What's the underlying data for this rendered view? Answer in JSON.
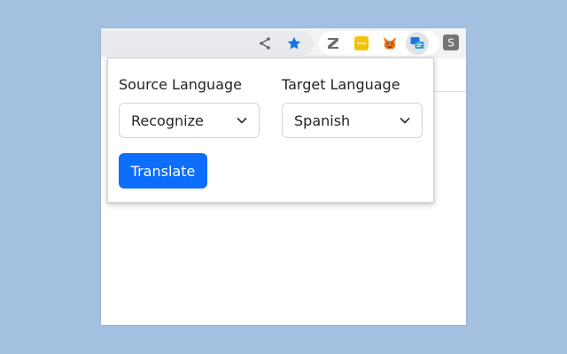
{
  "toolbar": {
    "icons": [
      "share-icon",
      "bookmark-star-icon"
    ],
    "extensions": [
      {
        "name": "zotero-extension-icon",
        "letter": "Z",
        "color": "#6b6b6b"
      },
      {
        "name": "password-manager-extension-icon",
        "color": "#f4c20d"
      },
      {
        "name": "metamask-fox-extension-icon",
        "color": "#e2761b"
      },
      {
        "name": "translator-extension-icon",
        "color": "#1a73e8"
      },
      {
        "name": "s-extension-icon",
        "letter": "S",
        "color": "#757575"
      }
    ],
    "accent": "#1a73e8"
  },
  "popup": {
    "source_label": "Source Language",
    "source_value": "Recognize",
    "target_label": "Target Language",
    "target_value": "Spanish",
    "translate_label": "Translate",
    "button_color": "#0d6efd"
  }
}
